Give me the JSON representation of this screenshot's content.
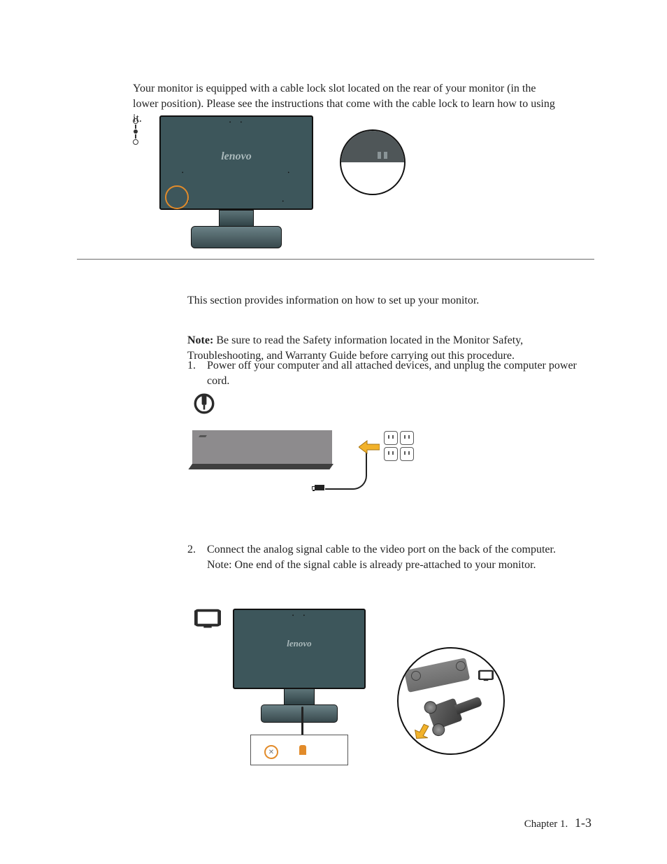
{
  "intro": "Your monitor is equipped with a cable lock slot located on the rear of your monitor (in the lower position). Please see the instructions that come with the cable lock to learn how to using it.",
  "brand": "lenovo",
  "section_intro": "This section provides information on how to set up your monitor.",
  "note": {
    "label": "Note:",
    "text_a": "Be sure to read the Safety information located in the Monitor Safety, Troubleshooting, and Warranty Guide before",
    "text_b": "carrying out this procedure."
  },
  "steps": {
    "s1": {
      "num": "1.",
      "text": "Power off your computer and all attached devices, and unplug the computer power cord."
    },
    "s2": {
      "num": "2.",
      "text_a": "Connect the analog signal cable to the video port on the back of the computer.",
      "text_b": "Note:   One end of the signal cable is already pre-attached to your monitor."
    }
  },
  "footer": {
    "chapter": "Chapter 1.",
    "page": "1-3"
  }
}
